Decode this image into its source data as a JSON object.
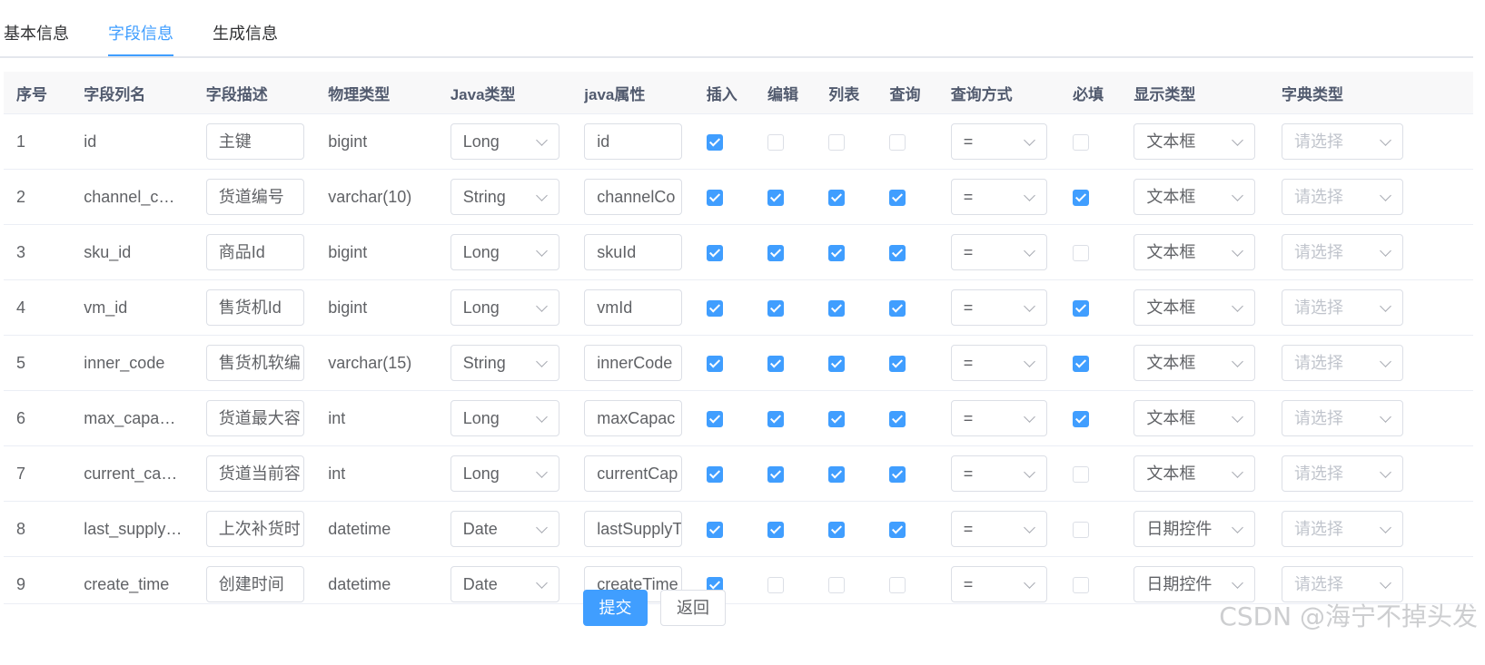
{
  "tabs": [
    {
      "label": "基本信息",
      "active": false
    },
    {
      "label": "字段信息",
      "active": true
    },
    {
      "label": "生成信息",
      "active": false
    }
  ],
  "table": {
    "headers": [
      "序号",
      "字段列名",
      "字段描述",
      "物理类型",
      "Java类型",
      "java属性",
      "插入",
      "编辑",
      "列表",
      "查询",
      "查询方式",
      "必填",
      "显示类型",
      "字典类型"
    ],
    "dict_placeholder": "请选择",
    "rows": [
      {
        "no": "1",
        "column": "id",
        "desc": "主键",
        "phys": "bigint",
        "java": "Long",
        "prop": "id",
        "insert": true,
        "edit": false,
        "list": false,
        "query": false,
        "query_type": "=",
        "required": false,
        "html": "文本框"
      },
      {
        "no": "2",
        "column": "channel_co…",
        "desc": "货道编号",
        "phys": "varchar(10)",
        "java": "String",
        "prop": "channelCo",
        "insert": true,
        "edit": true,
        "list": true,
        "query": true,
        "query_type": "=",
        "required": true,
        "html": "文本框"
      },
      {
        "no": "3",
        "column": "sku_id",
        "desc": "商品Id",
        "phys": "bigint",
        "java": "Long",
        "prop": "skuId",
        "insert": true,
        "edit": true,
        "list": true,
        "query": true,
        "query_type": "=",
        "required": false,
        "html": "文本框"
      },
      {
        "no": "4",
        "column": "vm_id",
        "desc": "售货机Id",
        "phys": "bigint",
        "java": "Long",
        "prop": "vmId",
        "insert": true,
        "edit": true,
        "list": true,
        "query": true,
        "query_type": "=",
        "required": true,
        "html": "文本框"
      },
      {
        "no": "5",
        "column": "inner_code",
        "desc": "售货机软编",
        "phys": "varchar(15)",
        "java": "String",
        "prop": "innerCode",
        "insert": true,
        "edit": true,
        "list": true,
        "query": true,
        "query_type": "=",
        "required": true,
        "html": "文本框"
      },
      {
        "no": "6",
        "column": "max_capacity",
        "desc": "货道最大容",
        "phys": "int",
        "java": "Long",
        "prop": "maxCapac",
        "insert": true,
        "edit": true,
        "list": true,
        "query": true,
        "query_type": "=",
        "required": true,
        "html": "文本框"
      },
      {
        "no": "7",
        "column": "current_ca…",
        "desc": "货道当前容",
        "phys": "int",
        "java": "Long",
        "prop": "currentCap",
        "insert": true,
        "edit": true,
        "list": true,
        "query": true,
        "query_type": "=",
        "required": false,
        "html": "文本框"
      },
      {
        "no": "8",
        "column": "last_supply…",
        "desc": "上次补货时",
        "phys": "datetime",
        "java": "Date",
        "prop": "lastSupplyT",
        "insert": true,
        "edit": true,
        "list": true,
        "query": true,
        "query_type": "=",
        "required": false,
        "html": "日期控件"
      },
      {
        "no": "9",
        "column": "create_time",
        "desc": "创建时间",
        "phys": "datetime",
        "java": "Date",
        "prop": "createTime",
        "insert": true,
        "edit": false,
        "list": false,
        "query": false,
        "query_type": "=",
        "required": false,
        "html": "日期控件"
      }
    ]
  },
  "buttons": {
    "submit": "提交",
    "back": "返回"
  },
  "watermark": "CSDN @海宁不掉头发",
  "colors": {
    "accent": "#409eff",
    "header_bg": "#f8f8f9",
    "border": "#dcdfe6"
  }
}
